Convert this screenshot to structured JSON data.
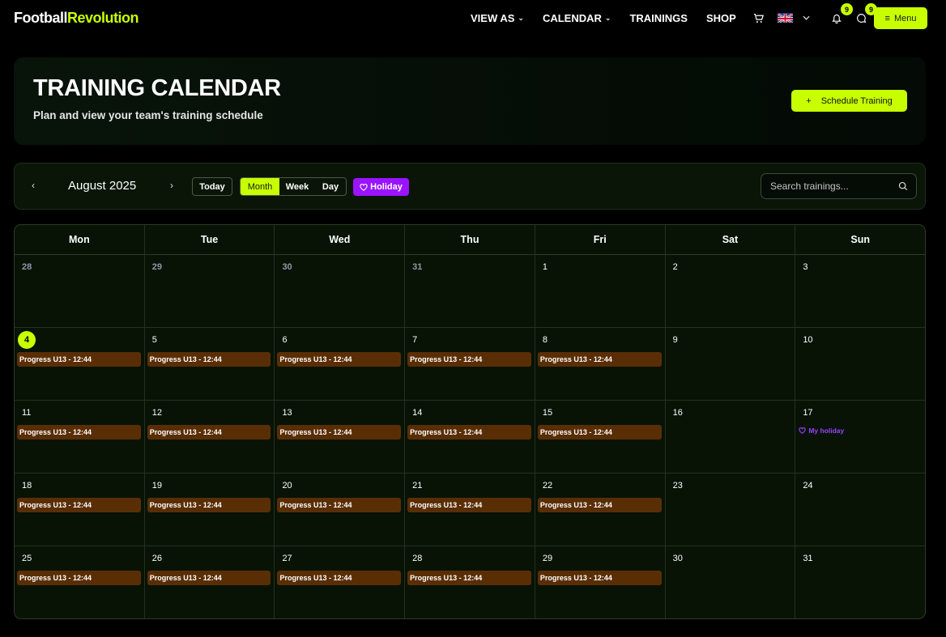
{
  "nav": {
    "logo_part1": "Football",
    "logo_part2": "Revolution",
    "links": [
      {
        "label": "VIEW AS",
        "dropdown": true
      },
      {
        "label": "CALENDAR",
        "dropdown": true
      },
      {
        "label": "TRAININGS",
        "dropdown": false
      },
      {
        "label": "SHOP",
        "dropdown": false
      }
    ],
    "notifications_count": "9",
    "messages_count": "9",
    "menu_label": "Menu",
    "icons": [
      "cart-icon",
      "uk-flag-icon",
      "chevron-down-icon",
      "bell-icon",
      "chat-icon",
      "hamburger-icon"
    ]
  },
  "hero": {
    "title": "TRAINING CALENDAR",
    "subtitle": "Plan and view your team's training schedule",
    "schedule_button": "Schedule Training",
    "schedule_icon": "+"
  },
  "toolbar": {
    "prev_icon": "‹",
    "next_icon": "›",
    "month_label": "August 2025",
    "today_label": "Today",
    "views": [
      {
        "label": "Month",
        "active": true
      },
      {
        "label": "Week",
        "active": false
      },
      {
        "label": "Day",
        "active": false
      }
    ],
    "holiday_label": "Holiday",
    "search_placeholder": "Search trainings..."
  },
  "calendar": {
    "weekdays": [
      "Mon",
      "Tue",
      "Wed",
      "Thu",
      "Fri",
      "Sat",
      "Sun"
    ],
    "accent_color": "#c8ff00",
    "event_color": "#5a2e05",
    "holiday_color": "#9a14ff",
    "weeks": [
      [
        {
          "day": "28",
          "muted": true,
          "events": []
        },
        {
          "day": "29",
          "muted": true,
          "events": []
        },
        {
          "day": "30",
          "muted": true,
          "events": []
        },
        {
          "day": "31",
          "muted": true,
          "events": []
        },
        {
          "day": "1",
          "events": []
        },
        {
          "day": "2",
          "events": []
        },
        {
          "day": "3",
          "events": []
        }
      ],
      [
        {
          "day": "4",
          "today": true,
          "events": [
            "Progress U13 - 12:44"
          ]
        },
        {
          "day": "5",
          "events": [
            "Progress U13 - 12:44"
          ]
        },
        {
          "day": "6",
          "events": [
            "Progress U13 - 12:44"
          ]
        },
        {
          "day": "7",
          "events": [
            "Progress U13 - 12:44"
          ]
        },
        {
          "day": "8",
          "events": [
            "Progress U13 - 12:44"
          ]
        },
        {
          "day": "9",
          "events": []
        },
        {
          "day": "10",
          "events": []
        }
      ],
      [
        {
          "day": "11",
          "events": [
            "Progress U13 - 12:44"
          ]
        },
        {
          "day": "12",
          "events": [
            "Progress U13 - 12:44"
          ]
        },
        {
          "day": "13",
          "events": [
            "Progress U13 - 12:44"
          ]
        },
        {
          "day": "14",
          "events": [
            "Progress U13 - 12:44"
          ]
        },
        {
          "day": "15",
          "events": [
            "Progress U13 - 12:44"
          ]
        },
        {
          "day": "16",
          "events": []
        },
        {
          "day": "17",
          "events": [],
          "holiday": "My holiday"
        }
      ],
      [
        {
          "day": "18",
          "events": [
            "Progress U13 - 12:44"
          ]
        },
        {
          "day": "19",
          "events": [
            "Progress U13 - 12:44"
          ]
        },
        {
          "day": "20",
          "events": [
            "Progress U13 - 12:44"
          ]
        },
        {
          "day": "21",
          "events": [
            "Progress U13 - 12:44"
          ]
        },
        {
          "day": "22",
          "events": [
            "Progress U13 - 12:44"
          ]
        },
        {
          "day": "23",
          "events": []
        },
        {
          "day": "24",
          "events": []
        }
      ],
      [
        {
          "day": "25",
          "events": [
            "Progress U13 - 12:44"
          ]
        },
        {
          "day": "26",
          "events": [
            "Progress U13 - 12:44"
          ]
        },
        {
          "day": "27",
          "events": [
            "Progress U13 - 12:44"
          ]
        },
        {
          "day": "28",
          "events": [
            "Progress U13 - 12:44"
          ]
        },
        {
          "day": "29",
          "events": [
            "Progress U13 - 12:44"
          ]
        },
        {
          "day": "30",
          "events": []
        },
        {
          "day": "31",
          "events": []
        }
      ]
    ]
  }
}
